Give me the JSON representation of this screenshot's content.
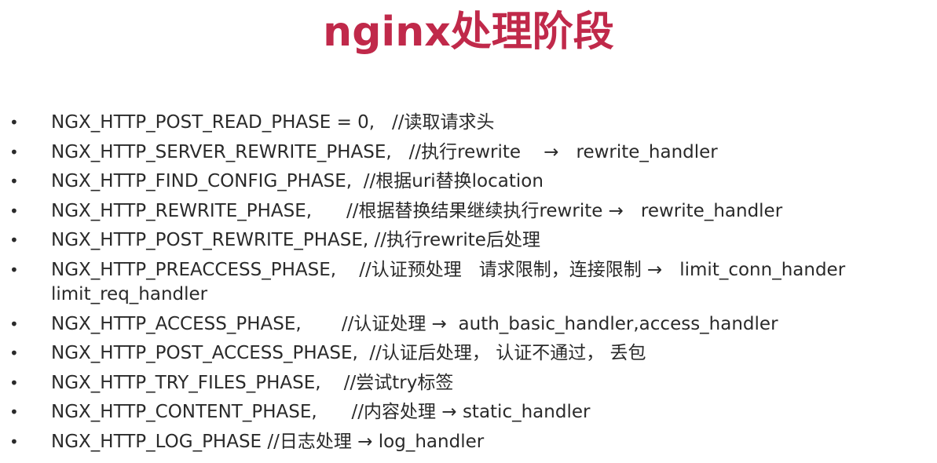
{
  "title": "nginx处理阶段",
  "bullet_glyph": "•",
  "items": [
    {
      "text": "NGX_HTTP_POST_READ_PHASE = 0,   //读取请求头"
    },
    {
      "text": "NGX_HTTP_SERVER_REWRITE_PHASE,   //执行rewrite    →   rewrite_handler"
    },
    {
      "text": "NGX_HTTP_FIND_CONFIG_PHASE,  //根据uri替换location"
    },
    {
      "text": "NGX_HTTP_REWRITE_PHASE,      //根据替换结果继续执行rewrite →   rewrite_handler"
    },
    {
      "text": "NGX_HTTP_POST_REWRITE_PHASE, //执行rewrite后处理"
    },
    {
      "text": "NGX_HTTP_PREACCESS_PHASE,    //认证预处理   请求限制，连接限制 →   limit_conn_hander limit_req_handler"
    },
    {
      "text": "NGX_HTTP_ACCESS_PHASE,       //认证处理 →  auth_basic_handler,access_handler"
    },
    {
      "text": "NGX_HTTP_POST_ACCESS_PHASE,  //认证后处理， 认证不通过， 丢包"
    },
    {
      "text": "NGX_HTTP_TRY_FILES_PHASE,    //尝试try标签"
    },
    {
      "text": "NGX_HTTP_CONTENT_PHASE,      //内容处理 → static_handler"
    },
    {
      "text": "NGX_HTTP_LOG_PHASE //日志处理 → log_handler"
    }
  ]
}
